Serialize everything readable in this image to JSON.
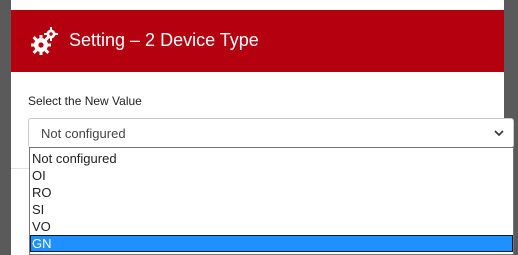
{
  "dialog": {
    "title": "Setting – 2 Device Type",
    "icon": "gears-icon",
    "header_color": "#b5000f"
  },
  "form": {
    "label": "Select the New Value",
    "selected_value": "Not configured"
  },
  "dropdown": {
    "options": [
      {
        "label": "Not configured",
        "highlighted": false
      },
      {
        "label": "OI",
        "highlighted": false
      },
      {
        "label": "RO",
        "highlighted": false
      },
      {
        "label": "SI",
        "highlighted": false
      },
      {
        "label": "VO",
        "highlighted": false
      },
      {
        "label": "GN",
        "highlighted": true
      }
    ],
    "highlight_color": "#1e90ff"
  }
}
